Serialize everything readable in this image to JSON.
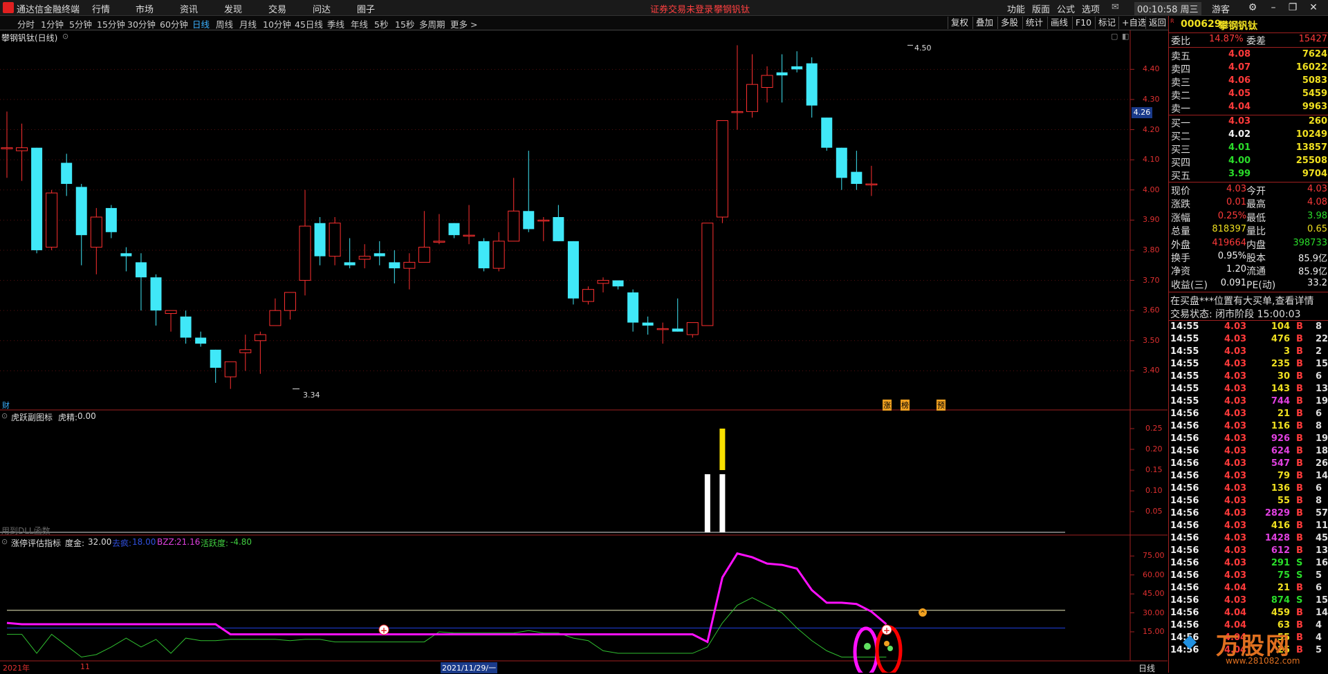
{
  "titlebar": {
    "app_name": "通达信金融终端",
    "menus": [
      "行情",
      "市场",
      "资讯",
      "发现",
      "交易",
      "问达",
      "圈子"
    ],
    "center_notice": "证券交易未登录",
    "center_stock": "攀钢钒钛",
    "right_menus": [
      "功能",
      "版面",
      "公式",
      "选项"
    ],
    "clock": "00:10:58 周三",
    "guest": "游客"
  },
  "toolbar": {
    "periods": [
      "分时",
      "1分钟",
      "5分钟",
      "15分钟",
      "30分钟",
      "60分钟",
      "日线",
      "周线",
      "月线",
      "10分钟",
      "45日线",
      "季线",
      "年线",
      "5秒",
      "15秒",
      "多周期",
      "更多 >"
    ],
    "active": "日线",
    "right_tools": [
      "复权",
      "叠加",
      "多股",
      "统计",
      "画线",
      "F10",
      "标记",
      "+自选",
      "返回"
    ]
  },
  "main_chart": {
    "title": "攀钢钒钛(日线)",
    "price_ticks": [
      "4.40",
      "4.30",
      "4.20",
      "4.10",
      "4.00",
      "3.90",
      "3.80",
      "3.70",
      "3.60",
      "3.50",
      "3.40"
    ],
    "current_price_tag": "4.26",
    "high_label": "4.50",
    "low_label": "3.34",
    "finance_marker": "财",
    "event_markers": [
      "涨",
      "榜",
      "预"
    ]
  },
  "indicator1": {
    "title": "虎跃副图标",
    "value_label": "虎精:",
    "value": "0.00",
    "ticks": [
      "0.25",
      "0.20",
      "0.15",
      "0.10",
      "0.05"
    ],
    "dll_note": "用到DLL函数"
  },
  "indicator2": {
    "title": "涨停评估指标",
    "param1_label": "度金:",
    "param1_value": "32.00",
    "param2_label": "去疯:",
    "param2_value": "18.00",
    "param3_label": "BZZ:",
    "param3_value": "21.16",
    "param4_label": "活跃度:",
    "param4_value": "-4.80",
    "ticks": [
      "75.00",
      "60.00",
      "45.00",
      "30.00",
      "15.00"
    ]
  },
  "date_axis": {
    "year": "2021年",
    "month": "11",
    "cursor_date": "2021/11/29/一",
    "period_label": "日线"
  },
  "quote_panel": {
    "code": "000629",
    "name": "攀钢钒钛",
    "weibi_label": "委比",
    "weibi": "14.87%",
    "weicha_label": "委差",
    "weicha": "15427",
    "asks": [
      {
        "label": "卖五",
        "price": "4.08",
        "vol": "7624"
      },
      {
        "label": "卖四",
        "price": "4.07",
        "vol": "16022"
      },
      {
        "label": "卖三",
        "price": "4.06",
        "vol": "5083"
      },
      {
        "label": "卖二",
        "price": "4.05",
        "vol": "5459"
      },
      {
        "label": "卖一",
        "price": "4.04",
        "vol": "9963"
      }
    ],
    "bids": [
      {
        "label": "买一",
        "price": "4.03",
        "vol": "260"
      },
      {
        "label": "买二",
        "price": "4.02",
        "vol": "10249"
      },
      {
        "label": "买三",
        "price": "4.01",
        "vol": "13857"
      },
      {
        "label": "买四",
        "price": "4.00",
        "vol": "25508"
      },
      {
        "label": "买五",
        "price": "3.99",
        "vol": "9704"
      }
    ],
    "stats": [
      {
        "k1": "现价",
        "v1": "4.03",
        "k2": "今开",
        "v2": "4.03"
      },
      {
        "k1": "涨跌",
        "v1": "0.01",
        "k2": "最高",
        "v2": "4.08"
      },
      {
        "k1": "涨幅",
        "v1": "0.25%",
        "k2": "最低",
        "v2": "3.98"
      },
      {
        "k1": "总量",
        "v1": "818397",
        "k2": "量比",
        "v2": "0.65"
      },
      {
        "k1": "外盘",
        "v1": "419664",
        "k2": "内盘",
        "v2": "398733"
      },
      {
        "k1": "换手",
        "v1": "0.95%",
        "k2": "股本",
        "v2": "85.9亿"
      },
      {
        "k1": "净资",
        "v1": "1.20",
        "k2": "流通",
        "v2": "85.9亿"
      },
      {
        "k1": "收益(三)",
        "v1": "0.091",
        "k2": "PE(动)",
        "v2": "33.2"
      }
    ],
    "notice": "在买盘***位置有大买单,查看详情",
    "trade_state": "交易状态: 闭市阶段 15:00:03",
    "ticks": [
      {
        "t": "14:55",
        "p": "4.03",
        "v": "104",
        "d": "B",
        "n": "8"
      },
      {
        "t": "14:55",
        "p": "4.03",
        "v": "476",
        "d": "B",
        "n": "22"
      },
      {
        "t": "14:55",
        "p": "4.03",
        "v": "3",
        "d": "B",
        "n": "2"
      },
      {
        "t": "14:55",
        "p": "4.03",
        "v": "235",
        "d": "B",
        "n": "15"
      },
      {
        "t": "14:55",
        "p": "4.03",
        "v": "30",
        "d": "B",
        "n": "6"
      },
      {
        "t": "14:55",
        "p": "4.03",
        "v": "143",
        "d": "B",
        "n": "13"
      },
      {
        "t": "14:55",
        "p": "4.03",
        "v": "744",
        "d": "B",
        "n": "19"
      },
      {
        "t": "14:56",
        "p": "4.03",
        "v": "21",
        "d": "B",
        "n": "6"
      },
      {
        "t": "14:56",
        "p": "4.03",
        "v": "116",
        "d": "B",
        "n": "8"
      },
      {
        "t": "14:56",
        "p": "4.03",
        "v": "926",
        "d": "B",
        "n": "19"
      },
      {
        "t": "14:56",
        "p": "4.03",
        "v": "624",
        "d": "B",
        "n": "18"
      },
      {
        "t": "14:56",
        "p": "4.03",
        "v": "547",
        "d": "B",
        "n": "26"
      },
      {
        "t": "14:56",
        "p": "4.03",
        "v": "79",
        "d": "B",
        "n": "14"
      },
      {
        "t": "14:56",
        "p": "4.03",
        "v": "136",
        "d": "B",
        "n": "6"
      },
      {
        "t": "14:56",
        "p": "4.03",
        "v": "55",
        "d": "B",
        "n": "8"
      },
      {
        "t": "14:56",
        "p": "4.03",
        "v": "2829",
        "d": "B",
        "n": "57"
      },
      {
        "t": "14:56",
        "p": "4.03",
        "v": "416",
        "d": "B",
        "n": "11"
      },
      {
        "t": "14:56",
        "p": "4.03",
        "v": "1428",
        "d": "B",
        "n": "45"
      },
      {
        "t": "14:56",
        "p": "4.03",
        "v": "612",
        "d": "B",
        "n": "13"
      },
      {
        "t": "14:56",
        "p": "4.03",
        "v": "291",
        "d": "S",
        "n": "16"
      },
      {
        "t": "14:56",
        "p": "4.03",
        "v": "75",
        "d": "S",
        "n": "5"
      },
      {
        "t": "14:56",
        "p": "4.04",
        "v": "21",
        "d": "B",
        "n": "6"
      },
      {
        "t": "14:56",
        "p": "4.03",
        "v": "874",
        "d": "S",
        "n": "15"
      },
      {
        "t": "14:56",
        "p": "4.04",
        "v": "459",
        "d": "B",
        "n": "14"
      },
      {
        "t": "14:56",
        "p": "4.04",
        "v": "63",
        "d": "B",
        "n": "4"
      },
      {
        "t": "14:56",
        "p": "4.04",
        "v": "55",
        "d": "B",
        "n": "4"
      },
      {
        "t": "14:56",
        "p": "4.04",
        "v": "25",
        "d": "B",
        "n": "5"
      }
    ]
  },
  "watermark": "万股网",
  "watermark_url": "www.281082.com",
  "chart_data": {
    "type": "candlestick",
    "y_range": [
      3.3,
      4.52
    ],
    "candles": [
      [
        4.14,
        4.14,
        4.04,
        4.26
      ],
      [
        4.13,
        4.14,
        4.03,
        4.22
      ],
      [
        4.14,
        3.8,
        3.79,
        4.14
      ],
      [
        3.81,
        3.99,
        3.8,
        4.0
      ],
      [
        4.09,
        4.02,
        3.98,
        4.12
      ],
      [
        4.01,
        3.85,
        3.75,
        4.02
      ],
      [
        3.81,
        3.91,
        3.72,
        3.94
      ],
      [
        3.94,
        3.86,
        3.84,
        3.95
      ],
      [
        3.79,
        3.78,
        3.73,
        3.81
      ],
      [
        3.76,
        3.71,
        3.6,
        3.79
      ],
      [
        3.71,
        3.6,
        3.55,
        3.72
      ],
      [
        3.59,
        3.6,
        3.53,
        3.6
      ],
      [
        3.58,
        3.51,
        3.49,
        3.6
      ],
      [
        3.51,
        3.49,
        3.48,
        3.53
      ],
      [
        3.47,
        3.41,
        3.36,
        3.47
      ],
      [
        3.38,
        3.43,
        3.34,
        3.43
      ],
      [
        3.46,
        3.47,
        3.4,
        3.52
      ],
      [
        3.5,
        3.52,
        3.39,
        3.53
      ],
      [
        3.55,
        3.6,
        3.55,
        3.64
      ],
      [
        3.6,
        3.66,
        3.57,
        3.66
      ],
      [
        3.7,
        3.88,
        3.65,
        4.0
      ],
      [
        3.89,
        3.78,
        3.75,
        3.91
      ],
      [
        3.78,
        3.89,
        3.75,
        3.91
      ],
      [
        3.76,
        3.75,
        3.74,
        3.84
      ],
      [
        3.77,
        3.78,
        3.74,
        3.82
      ],
      [
        3.79,
        3.78,
        3.75,
        3.83
      ],
      [
        3.76,
        3.74,
        3.69,
        3.8
      ],
      [
        3.74,
        3.76,
        3.67,
        3.79
      ],
      [
        3.76,
        3.81,
        3.76,
        3.93
      ],
      [
        3.83,
        3.83,
        3.82,
        3.92
      ],
      [
        3.89,
        3.85,
        3.84,
        3.89
      ],
      [
        3.85,
        3.85,
        3.82,
        3.95
      ],
      [
        3.83,
        3.74,
        3.73,
        3.84
      ],
      [
        3.74,
        3.83,
        3.73,
        3.86
      ],
      [
        3.83,
        3.93,
        3.83,
        4.04
      ],
      [
        3.93,
        3.87,
        3.86,
        4.13
      ],
      [
        3.9,
        3.9,
        3.83,
        3.91
      ],
      [
        3.91,
        3.83,
        3.83,
        3.95
      ],
      [
        3.83,
        3.64,
        3.62,
        3.83
      ],
      [
        3.63,
        3.67,
        3.62,
        3.68
      ],
      [
        3.69,
        3.7,
        3.66,
        3.71
      ],
      [
        3.7,
        3.68,
        3.67,
        3.7
      ],
      [
        3.66,
        3.56,
        3.53,
        3.67
      ],
      [
        3.56,
        3.55,
        3.52,
        3.58
      ],
      [
        3.54,
        3.54,
        3.49,
        3.56
      ],
      [
        3.54,
        3.53,
        3.53,
        3.64
      ],
      [
        3.52,
        3.56,
        3.51,
        3.56
      ],
      [
        3.55,
        3.89,
        3.55,
        3.89
      ],
      [
        3.91,
        4.23,
        3.89,
        4.23
      ],
      [
        4.26,
        4.26,
        4.2,
        4.48
      ],
      [
        4.26,
        4.35,
        4.24,
        4.45
      ],
      [
        4.34,
        4.38,
        4.29,
        4.41
      ],
      [
        4.39,
        4.38,
        4.29,
        4.45
      ],
      [
        4.41,
        4.4,
        4.39,
        4.46
      ],
      [
        4.42,
        4.28,
        4.24,
        4.44
      ],
      [
        4.24,
        4.14,
        4.13,
        4.24
      ],
      [
        4.14,
        4.04,
        4.0,
        4.14
      ],
      [
        4.06,
        4.02,
        4.0,
        4.13
      ],
      [
        4.02,
        4.02,
        3.98,
        4.08
      ]
    ],
    "ind1_bars": [
      {
        "index": 47,
        "value": 0.14,
        "color": "white"
      },
      {
        "index": 48,
        "value": 0.14,
        "color": "white"
      },
      {
        "index": 48,
        "value": 0.1,
        "color": "yellow",
        "base": 0.15
      }
    ],
    "ind2_magenta": [
      22,
      21,
      21,
      21,
      21,
      21,
      21,
      21,
      21,
      21,
      21,
      21,
      21,
      21,
      21,
      13,
      13,
      13,
      13,
      13,
      13,
      13,
      13,
      13,
      13,
      13,
      13,
      13,
      13,
      13,
      13,
      13,
      13,
      13,
      13,
      13,
      13,
      13,
      13,
      13,
      13,
      13,
      13,
      13,
      13,
      13,
      13,
      7,
      58,
      77,
      74,
      69,
      68,
      65,
      48,
      38,
      38,
      37,
      31,
      21
    ],
    "ind2_green": [
      13,
      13,
      -2,
      13,
      4,
      -5,
      -3,
      3,
      10,
      3,
      9,
      -2,
      10,
      8,
      8,
      9,
      9,
      9,
      9,
      8,
      9,
      9,
      7,
      7,
      7,
      7,
      7,
      7,
      7,
      15,
      14,
      14,
      14,
      14,
      14,
      16,
      14,
      14,
      10,
      8,
      0,
      -2,
      -2,
      -2,
      -2,
      -2,
      -2,
      3,
      22,
      36,
      42,
      36,
      30,
      18,
      8,
      0,
      -5,
      -5,
      -5,
      -5
    ],
    "ind2_ref_lines": [
      32,
      18
    ]
  }
}
